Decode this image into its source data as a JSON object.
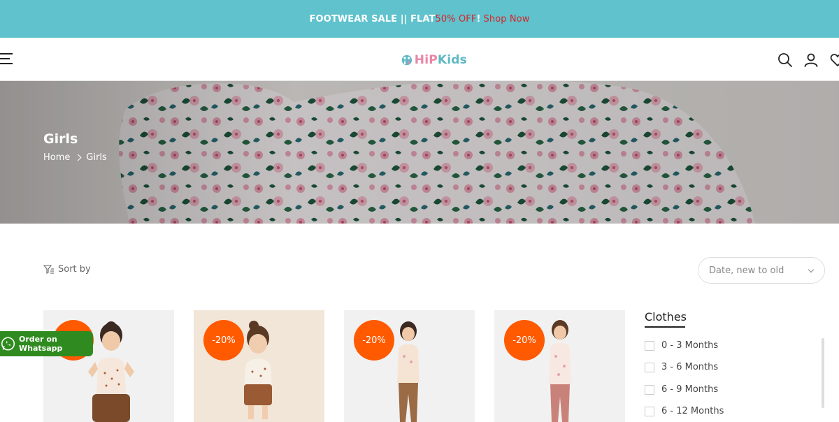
{
  "announcement": {
    "prefix": "FOOTWEAR SALE || FLAT ",
    "discount": "50% OFF",
    "separator": " !",
    "link": "Shop Now"
  },
  "header": {
    "logo_text_h": "HiP",
    "logo_text_k": "Kids",
    "icons": [
      "menu-icon",
      "search-icon",
      "user-icon",
      "heart-icon"
    ]
  },
  "hero": {
    "title": "Girls",
    "breadcrumb": [
      "Home",
      "Girls"
    ]
  },
  "toolbar": {
    "sort_label": "Sort by",
    "sort_value": "Date, new to old"
  },
  "products": [
    {
      "badge": "-20%"
    },
    {
      "badge": "-20%"
    },
    {
      "badge": "-20%"
    },
    {
      "badge": "-20%"
    }
  ],
  "filters": {
    "title": "Clothes",
    "options": [
      "0 - 3 Months",
      "3 - 6 Months",
      "6 - 9 Months",
      "6 - 12 Months"
    ]
  },
  "whatsapp": {
    "label": "Order on Whatsapp"
  },
  "colors": {
    "accent": "#5fc2cc",
    "sale": "#ff5a00",
    "whatsapp": "#2f8b1f",
    "promo_red": "#d8252b"
  }
}
